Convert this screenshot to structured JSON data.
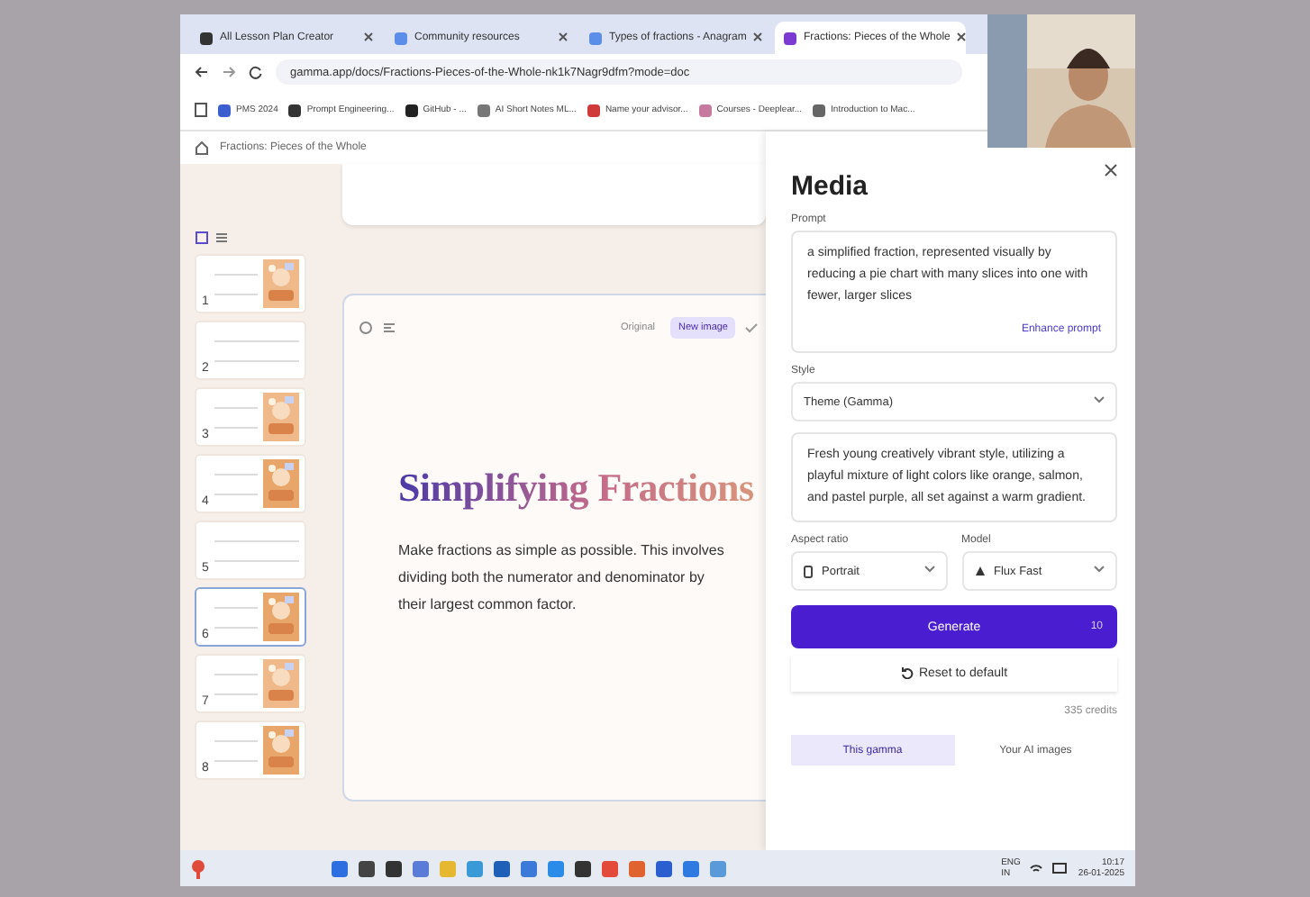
{
  "browser": {
    "tabs": [
      {
        "label": "All Lesson Plan Creator",
        "selected": false
      },
      {
        "label": "Community resources",
        "selected": false
      },
      {
        "label": "Types of fractions - Anagram",
        "selected": false
      },
      {
        "label": "Fractions: Pieces of the Whole",
        "selected": true
      }
    ],
    "url": "gamma.app/docs/Fractions-Pieces-of-the-Whole-nk1k7Nagr9dfm?mode=doc",
    "bookmarks": [
      "PMS 2024",
      "Prompt Engineering...",
      "GitHub - ...",
      "AI Short Notes ML...",
      "Name your advisor...",
      "Courses - Deeplear...",
      "Introduction to Mac..."
    ]
  },
  "breadcrumb": "Fractions: Pieces of the Whole",
  "slides": [
    {
      "number": "1",
      "selected": false
    },
    {
      "number": "2",
      "kind": "text",
      "selected": false
    },
    {
      "number": "3",
      "selected": false
    },
    {
      "number": "4",
      "selected": false
    },
    {
      "number": "5",
      "kind": "text",
      "selected": false
    },
    {
      "number": "6",
      "selected": true
    },
    {
      "number": "7",
      "selected": false
    },
    {
      "number": "8",
      "selected": false
    }
  ],
  "card": {
    "image_toggle": [
      {
        "label": "Original",
        "selected": false
      },
      {
        "label": "New image",
        "selected": true
      }
    ],
    "title": "Simplifying Fractions",
    "body": "Make fractions as simple as possible. This involves dividing both the numerator and denominator by their largest common factor."
  },
  "media": {
    "title": "Media",
    "prompt_label": "Prompt",
    "prompt": "a simplified fraction, represented visually by reducing a pie chart with many slices into one with fewer, larger slices",
    "enhance": "Enhance prompt",
    "style_label": "Style",
    "style": "Theme (Gamma)",
    "style_description": "Fresh young creatively vibrant style, utilizing a playful mixture of light colors like orange, salmon, and pastel purple, all set against a warm gradient.",
    "aspect_label": "Aspect ratio",
    "aspect": "Portrait",
    "model_label": "Model",
    "model": "Flux Fast",
    "generate": "Generate",
    "generate_cost": "10",
    "reset": "Reset to default",
    "credits": "335 credits",
    "tabs": [
      {
        "label": "This gamma",
        "selected": true
      },
      {
        "label": "Your AI images",
        "selected": false
      }
    ]
  },
  "taskbar": {
    "tray": [
      "ENG",
      "IN"
    ],
    "time": "10:17",
    "date": "26-01-2025"
  }
}
